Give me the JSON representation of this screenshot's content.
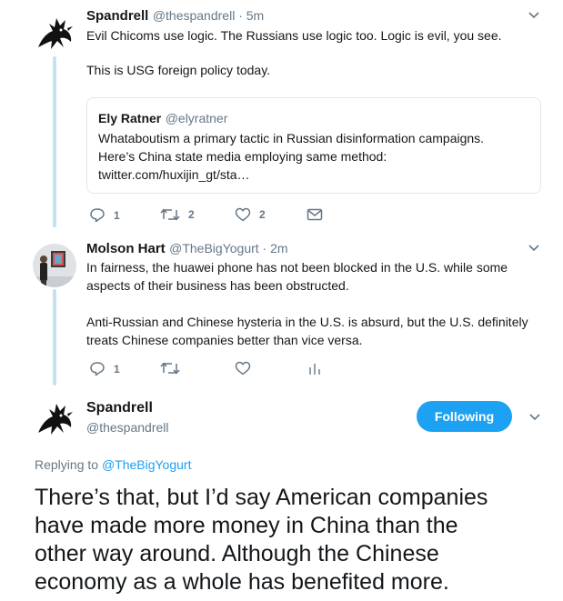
{
  "tweet1": {
    "name": "Spandrell",
    "handle_time": "@thespandrell · 5m",
    "line1": "Evil Chicoms use logic. The Russians use logic too. Logic is evil, you see.",
    "line2": "This is USG foreign policy today.",
    "quote": {
      "name": "Ely Ratner",
      "handle": "@elyratner",
      "line1": "Whataboutism a primary tactic in Russian disinformation campaigns.",
      "line2": "Here’s China state media employing same method:",
      "line3": "twitter.com/huxijin_gt/sta…"
    },
    "actions": {
      "reply_count": "1",
      "retweet_count": "2",
      "like_count": "2"
    },
    "icons": [
      "reply-icon",
      "retweet-icon",
      "like-icon",
      "message-icon",
      "chevron-down-icon"
    ]
  },
  "tweet2": {
    "name": "Molson Hart",
    "handle_time": "@TheBigYogurt · 2m",
    "para1_line1": "In fairness, the huawei phone has not been blocked in the U.S. while some",
    "para1_line2": "aspects of their business has been obstructed.",
    "para2_line1": "Anti-Russian and Chinese hysteria in the U.S. is absurd, but the U.S. definitely",
    "para2_line2": "treats Chinese companies better than vice versa.",
    "actions": {
      "reply_count": "1"
    },
    "icons": [
      "reply-icon",
      "retweet-icon",
      "like-icon",
      "analytics-icon",
      "chevron-down-icon"
    ]
  },
  "focus_tweet": {
    "name": "Spandrell",
    "handle": "@thespandrell",
    "follow_label": "Following",
    "replying_prefix": "Replying to ",
    "replying_handle": "@TheBigYogurt",
    "text_line1": "There’s that, but I’d say American companies",
    "text_line2": "have made more money in China than the",
    "text_line3": "other way around. Although the Chinese",
    "text_line4": "economy as a whole has benefited more."
  },
  "colors": {
    "accent": "#1da1f2",
    "thread_line": "#c4e2f5",
    "muted": "#657786",
    "border": "#e1e8ed"
  }
}
